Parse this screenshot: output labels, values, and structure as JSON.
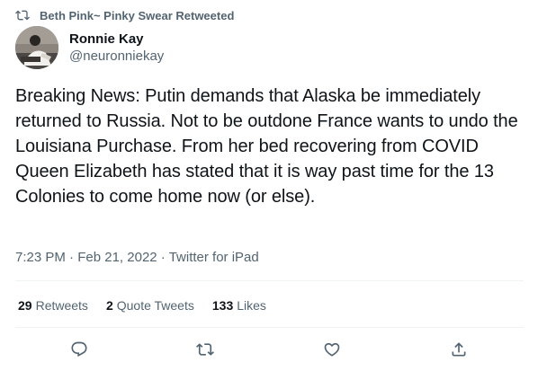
{
  "retweet_banner": {
    "text": "Beth Pink~ Pinky Swear Retweeted",
    "icon": "retweet-icon"
  },
  "author": {
    "display_name": "Ronnie Kay",
    "handle": "@neuronniekay"
  },
  "tweet": {
    "text": "Breaking News: Putin demands that Alaska be immediately returned to Russia. Not to be outdone France wants to undo the Louisiana Purchase. From her bed recovering from COVID Queen Elizabeth has stated that it is way past time for the 13 Colonies to come home now (or else).",
    "time": "7:23 PM",
    "date": "Feb 21, 2022",
    "separator": " · ",
    "source": "Twitter for iPad"
  },
  "stats": {
    "retweets_count": "29",
    "retweets_label": "Retweets",
    "quote_tweets_count": "2",
    "quote_tweets_label": "Quote Tweets",
    "likes_count": "133",
    "likes_label": "Likes"
  },
  "actions": {
    "reply_icon": "reply-icon",
    "retweet_icon": "retweet-icon",
    "like_icon": "heart-icon",
    "share_icon": "share-icon"
  },
  "colors": {
    "text_primary": "#0f1419",
    "text_secondary": "#536471",
    "divider": "#eff3f4"
  }
}
